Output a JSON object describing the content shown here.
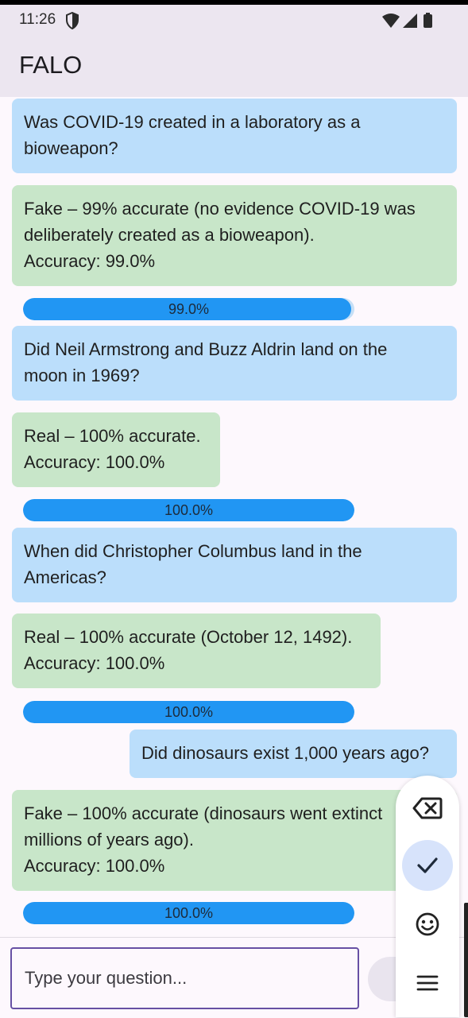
{
  "status_bar": {
    "time": "11:26"
  },
  "app_bar": {
    "title": "FALO"
  },
  "messages": [
    {
      "role": "question",
      "text": "Was COVID-19 created in a laboratory as a\nbioweapon?"
    },
    {
      "role": "answer",
      "text": "Fake – 99% accurate (no evidence COVID-19 was\ndeliberately created as a bioweapon).\nAccuracy: 99.0%",
      "bar_label": "99.0%",
      "accuracy": 0.99
    },
    {
      "role": "question",
      "text": "Did Neil Armstrong and Buzz Aldrin land on the\nmoon in 1969?"
    },
    {
      "role": "answer",
      "text": "Real – 100% accurate.\nAccuracy: 100.0%",
      "bar_label": "100.0%",
      "accuracy": 1.0
    },
    {
      "role": "question",
      "text": "When did Christopher Columbus land in the\nAmericas?"
    },
    {
      "role": "answer",
      "text": "Real – 100% accurate (October 12, 1492).\nAccuracy: 100.0%",
      "bar_label": "100.0%",
      "accuracy": 1.0
    },
    {
      "role": "question",
      "text": "Did dinosaurs exist 1,000 years ago?"
    },
    {
      "role": "answer",
      "text": "Fake – 100% accurate (dinosaurs went extinct\nmillions of years ago).\nAccuracy: 100.0%",
      "bar_label": "100.0%",
      "accuracy": 1.0
    }
  ],
  "composer": {
    "placeholder": "Type your question..."
  },
  "keyboard_toolbar": {
    "icons": [
      "backspace-icon",
      "check-icon",
      "emoji-icon",
      "menu-icon"
    ]
  },
  "colors": {
    "question_bubble": "#bbdefb",
    "answer_bubble": "#c8e6c9",
    "progress_fill": "#2196f3",
    "app_bar": "#ece6f0",
    "input_border": "#6750a4"
  }
}
